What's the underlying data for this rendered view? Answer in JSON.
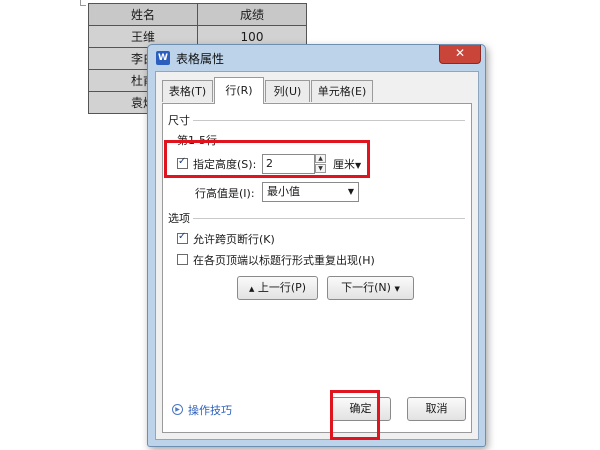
{
  "document_table": {
    "rows": [
      [
        "姓名",
        "成绩"
      ],
      [
        "王维",
        "100"
      ],
      [
        "李白",
        ""
      ],
      [
        "杜甫",
        ""
      ],
      [
        "袁焕",
        ""
      ]
    ]
  },
  "dialog": {
    "app_icon_text": "W",
    "title": "表格属性",
    "close_glyph": "✕",
    "tabs": [
      "表格(T)",
      "行(R)",
      "列(U)",
      "单元格(E)"
    ],
    "active_tab_index": 1,
    "size_group": {
      "title": "尺寸",
      "rows_label": "第1-5行",
      "specify_height_label": "指定高度(S):",
      "specify_height_checked": true,
      "height_value": "2",
      "height_unit": "厘米",
      "row_height_mode_label": "行高值是(I):",
      "row_height_mode_value": "最小值"
    },
    "options_group": {
      "title": "选项",
      "allow_break_label": "允许跨页断行(K)",
      "allow_break_checked": true,
      "repeat_header_label": "在各页顶端以标题行形式重复出现(H)",
      "repeat_header_checked": false
    },
    "prev_row_label": "上一行(P)",
    "next_row_label": "下一行(N)",
    "tips_label": "操作技巧",
    "ok_label": "确定",
    "cancel_label": "取消"
  },
  "colors": {
    "highlight_red": "#e0141e",
    "dialog_frame": "#bcd3ea",
    "close_button": "#c9453a"
  }
}
